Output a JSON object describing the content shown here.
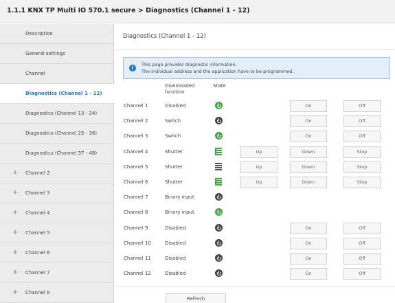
{
  "window": {
    "title": "1.1.1 KNX TP Multi IO 570.1 secure > Diagnostics (Channel 1 - 12)"
  },
  "sidebar": {
    "items": [
      {
        "label": "Description",
        "expandable": false
      },
      {
        "label": "General settings",
        "expandable": false
      },
      {
        "label": "Channel",
        "expandable": false
      },
      {
        "label": "Diagnostics (Channel 1 - 12)",
        "expandable": false,
        "active": true
      },
      {
        "label": "Diagnostics (Channel 13 - 24)",
        "expandable": false
      },
      {
        "label": "Diagnostics (Channel 25 - 36)",
        "expandable": false
      },
      {
        "label": "Diagnostics (Channel 37 - 48)",
        "expandable": false
      },
      {
        "label": "Channel 2",
        "expandable": true
      },
      {
        "label": "Channel 3",
        "expandable": true
      },
      {
        "label": "Channel 4",
        "expandable": true
      },
      {
        "label": "Channel 5",
        "expandable": true
      },
      {
        "label": "Channel 6",
        "expandable": true
      },
      {
        "label": "Channel 7",
        "expandable": true
      },
      {
        "label": "Channel 8",
        "expandable": true
      }
    ],
    "expand_glyph": "+"
  },
  "main": {
    "title": "Diagnostics (Channel 1 - 12)",
    "info": {
      "icon": "info-icon",
      "line1": "This page provides diagnostic information.",
      "line2": "The individual address and the application have to be programmed."
    },
    "headers": {
      "function_line1": "Downloaded",
      "function_line2": "function",
      "state": "State"
    },
    "channels": [
      {
        "name": "Channel 1",
        "function": "Disabled",
        "state_icon": "power-icon",
        "state_on": true,
        "buttons": [
          "On",
          "Off"
        ]
      },
      {
        "name": "Channel 2",
        "function": "Switch",
        "state_icon": "power-icon",
        "state_on": false,
        "buttons": [
          "On",
          "Off"
        ]
      },
      {
        "name": "Channel 3",
        "function": "Switch",
        "state_icon": "power-icon",
        "state_on": true,
        "buttons": [
          "On",
          "Off"
        ]
      },
      {
        "name": "Channel 4",
        "function": "Shutter",
        "state_icon": "blind-icon",
        "state_on": true,
        "buttons": [
          "Up",
          "Down",
          "Stop"
        ]
      },
      {
        "name": "Channel 5",
        "function": "Shutter",
        "state_icon": "blind-icon",
        "state_on": false,
        "buttons": [
          "Up",
          "Down",
          "Stop"
        ]
      },
      {
        "name": "Channel 6",
        "function": "Shutter",
        "state_icon": "blind-icon",
        "state_on": true,
        "buttons": [
          "Up",
          "Down",
          "Stop"
        ]
      },
      {
        "name": "Channel 7",
        "function": "Binary input",
        "state_icon": "power-icon",
        "state_on": false,
        "buttons": []
      },
      {
        "name": "Channel 8",
        "function": "Binary input",
        "state_icon": "power-icon",
        "state_on": true,
        "buttons": []
      },
      {
        "name": "Channel 9",
        "function": "Disabled",
        "state_icon": "power-icon",
        "state_on": false,
        "buttons": [
          "On",
          "Off"
        ]
      },
      {
        "name": "Channel 10",
        "function": "Disabled",
        "state_icon": "power-icon",
        "state_on": false,
        "buttons": [
          "On",
          "Off"
        ]
      },
      {
        "name": "Channel 11",
        "function": "Disabled",
        "state_icon": "power-icon",
        "state_on": false,
        "buttons": [
          "On",
          "Off"
        ]
      },
      {
        "name": "Channel 12",
        "function": "Disabled",
        "state_icon": "power-icon",
        "state_on": false,
        "buttons": [
          "On",
          "Off"
        ]
      }
    ],
    "refresh_label": "Refresh"
  },
  "colors": {
    "accent": "#1f78c8",
    "state_on": "#3cab3c",
    "state_off": "#444444",
    "info_bg": "#e4eef8"
  }
}
